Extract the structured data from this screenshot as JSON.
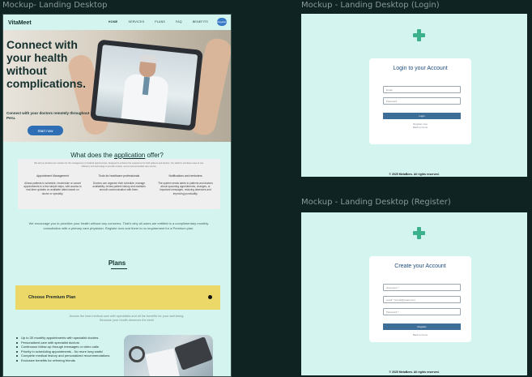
{
  "frames": {
    "landing": "Mockup- Landing Desktop",
    "login": "Mockup - Landing Desktop (Login)",
    "register": "Mockup - Landing Desktop (Register)"
  },
  "nav": {
    "brand": "VitaMeet",
    "links": [
      "HOME",
      "SERVICES",
      "PLANS",
      "FAQ",
      "BENEFITS"
    ],
    "button": "Register"
  },
  "hero": {
    "title": "Connect with your health without complications.",
    "subtitle": "Connect with your doctors remotely throughout Peru.",
    "cta": "Start now"
  },
  "offer": {
    "title_prefix": "What does the ",
    "title_underlined": "application",
    "title_suffix": " offer?",
    "intro": "We tell you all about our solution for the management of medical appointments, designed to enhance the experience for both patients and doctors. Our platform combines ease of use, efficiency and technology to provide a faster, secure and accessible care service.",
    "features": [
      {
        "title": "Appointment Management",
        "desc": "Allows patients to schedule, reschedule or cancel appointments in a few simple steps, with access to real-time updates on available dates based on doctor or specialty."
      },
      {
        "title": "Tools for healthcare professionals",
        "desc": "Doctors can organize their schedule, manage availability, review patient history and maintain smooth communication with them."
      },
      {
        "title": "Notifications and reminders",
        "desc": "The system sends alerts to patients and doctors about upcoming appointments, changes, or important messages, reducing absences and improving punctuality."
      }
    ]
  },
  "encourage": "We encourage you to prioritize your health without any concerns. That's why all users are entitled to a complimentary monthly consultation with a primary care physician. Register now and there is no requirement for a Premium plan.",
  "plans": {
    "title": "Plans",
    "choose": "Choose Premium Plan",
    "note": "Access the best medical care with specialists and all the benefits for your well-being. Because your health deserves the best!",
    "benefits": [
      "Up to 30 monthly appointments with specialist doctors",
      "Personalized care with specialist doctors",
      "Continuous follow-up through messages or video calls",
      "Priority in scheduling appointments - No more long waits!",
      "Complete medical history and personalized recommendations",
      "Exclusive benefits for referring friends"
    ]
  },
  "login": {
    "title": "Login to your Account",
    "email_placeholder": "Email",
    "password_placeholder": "Password",
    "submit": "Login",
    "register_link": "Register now",
    "back_link": "Back to home",
    "footer": "© 2025 MetaBees. All rights reserved."
  },
  "register": {
    "title": "Create your Account",
    "username_placeholder": "Username *",
    "email_placeholder": "email * (email@gmail.com)",
    "password_placeholder": "Password *",
    "submit": "Register",
    "back_link": "Back to home",
    "footer": "© 2025 MetaBees. All rights reserved."
  }
}
